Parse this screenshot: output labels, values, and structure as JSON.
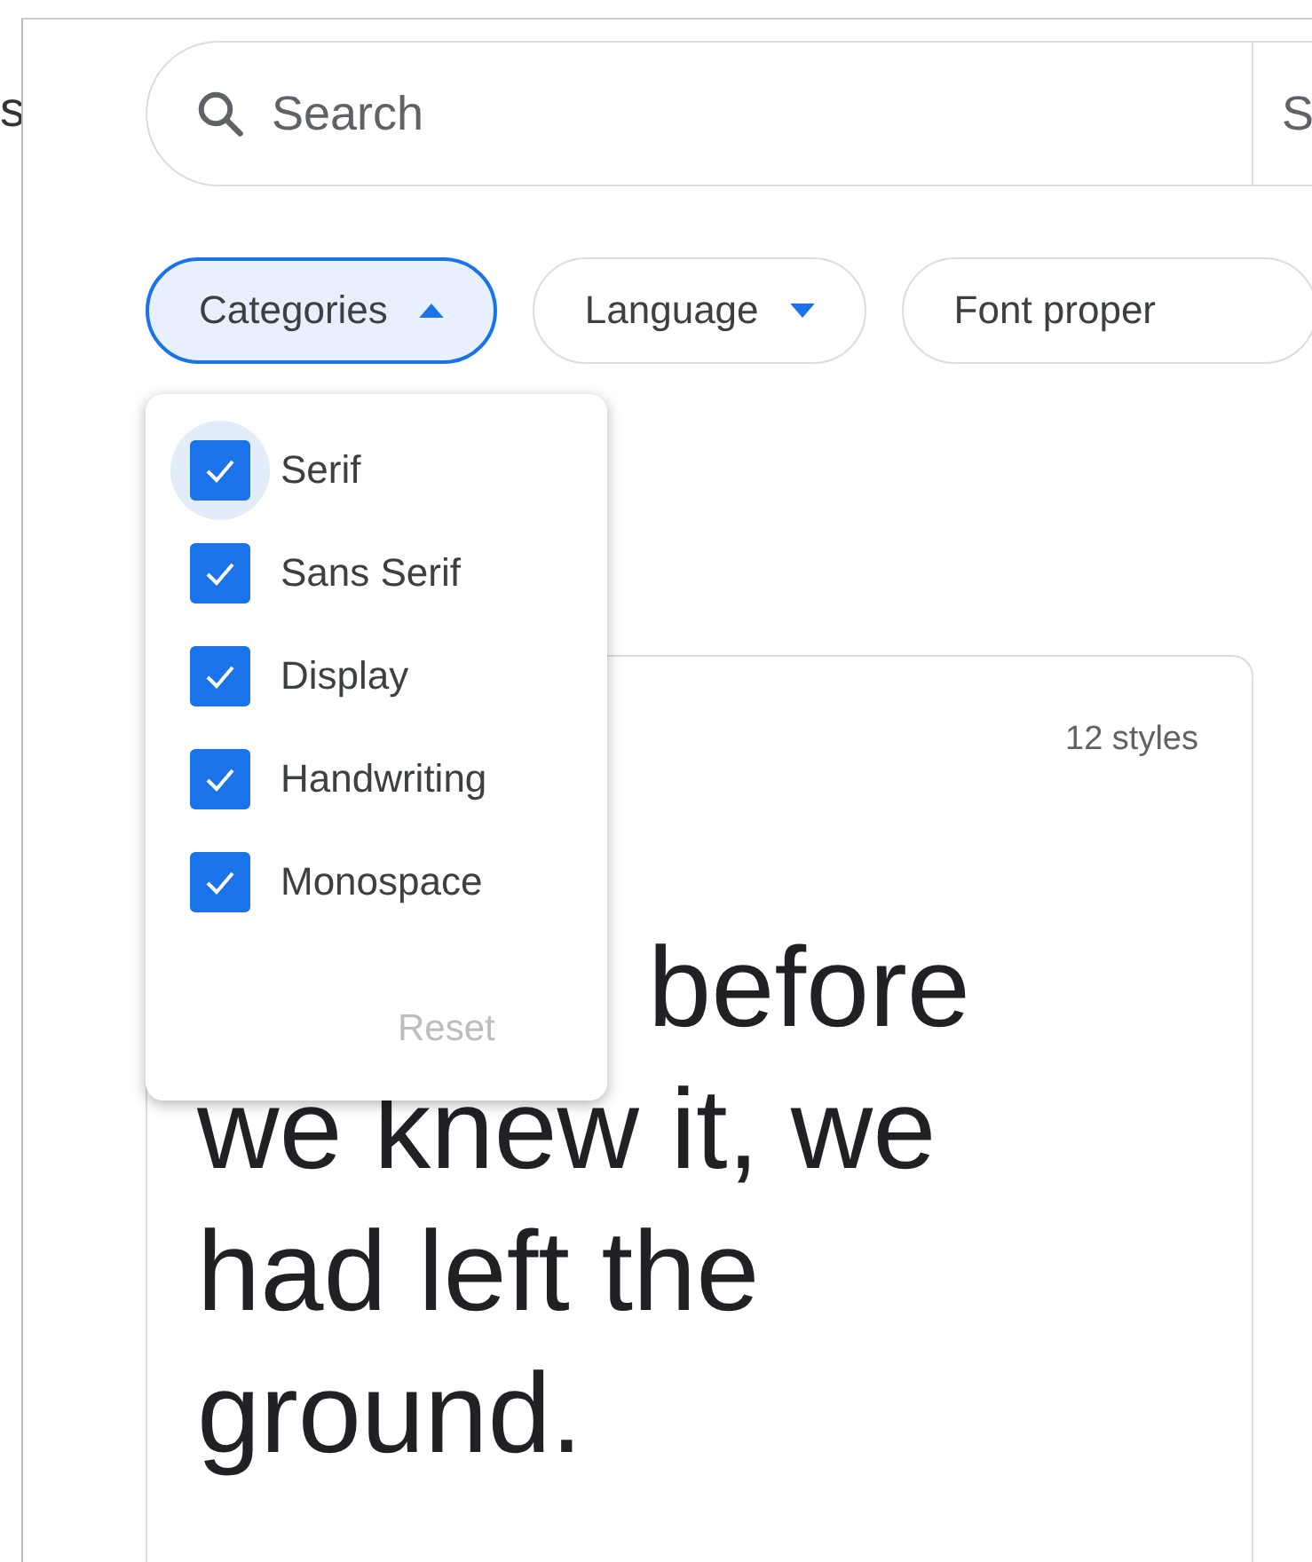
{
  "side_text": "s",
  "search": {
    "placeholder": "Search",
    "side_label": "S"
  },
  "filters": [
    {
      "label": "Categories",
      "expanded": true
    },
    {
      "label": "Language",
      "expanded": false
    },
    {
      "label": "Font proper"
    }
  ],
  "categories_menu": {
    "options": [
      {
        "label": "Serif",
        "checked": true,
        "focused": true
      },
      {
        "label": "Sans Serif",
        "checked": true,
        "focused": false
      },
      {
        "label": "Display",
        "checked": true,
        "focused": false
      },
      {
        "label": "Handwriting",
        "checked": true,
        "focused": false
      },
      {
        "label": "Monospace",
        "checked": true,
        "focused": false
      }
    ],
    "reset": {
      "label": "Reset",
      "disabled": true
    }
  },
  "font_card": {
    "styles": "12 styles",
    "preview_lines": [
      "before",
      "we knew it, we",
      "had left the",
      "ground."
    ]
  }
}
